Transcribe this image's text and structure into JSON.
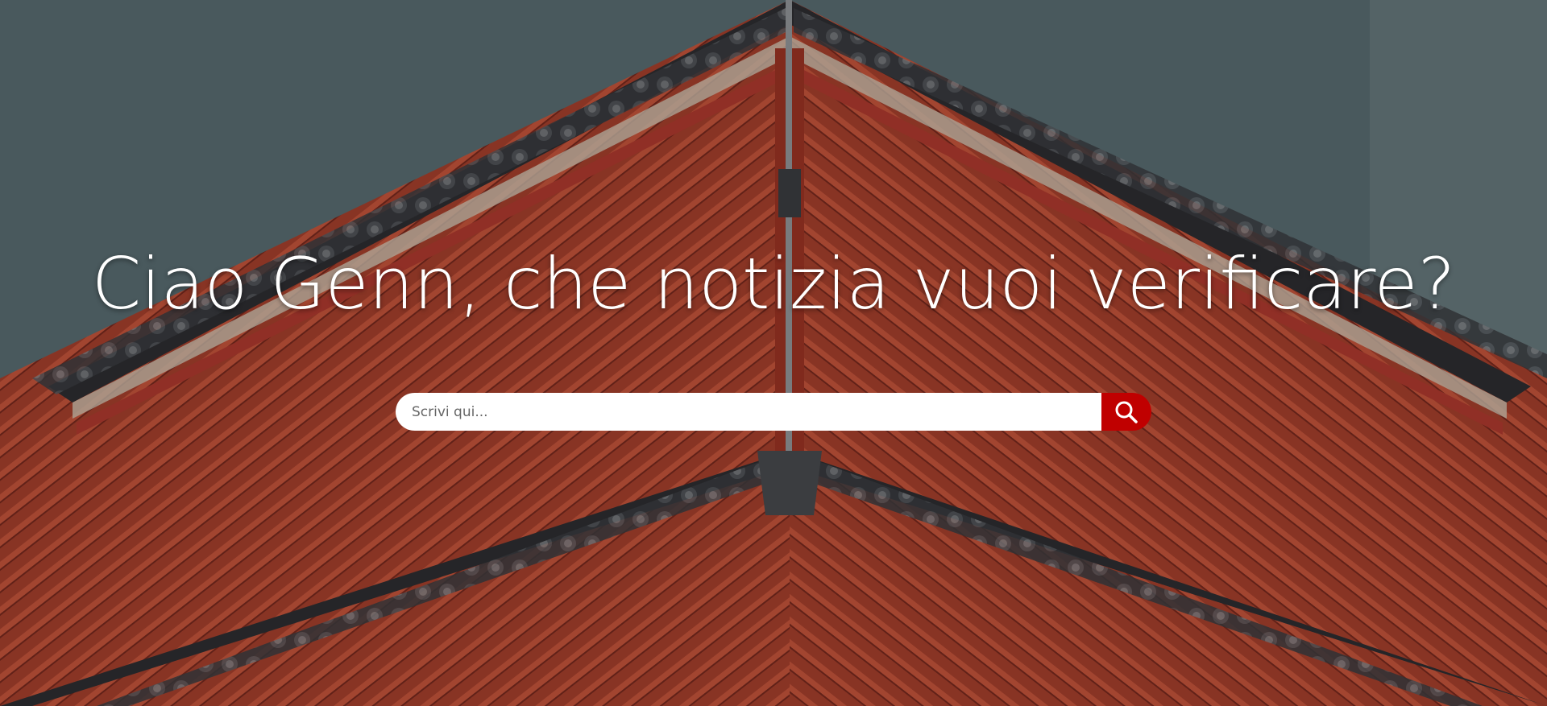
{
  "hero": {
    "headline": "Ciao Genn, che notizia vuoi verificare?",
    "background_icon": "pagoda-photo"
  },
  "search": {
    "placeholder": "Scrivi qui...",
    "value": "",
    "button_icon": "search-icon"
  },
  "colors": {
    "accent": "#c00000",
    "sky": "#4f6468",
    "roof": "#b8412a",
    "text": "#ffffff"
  }
}
